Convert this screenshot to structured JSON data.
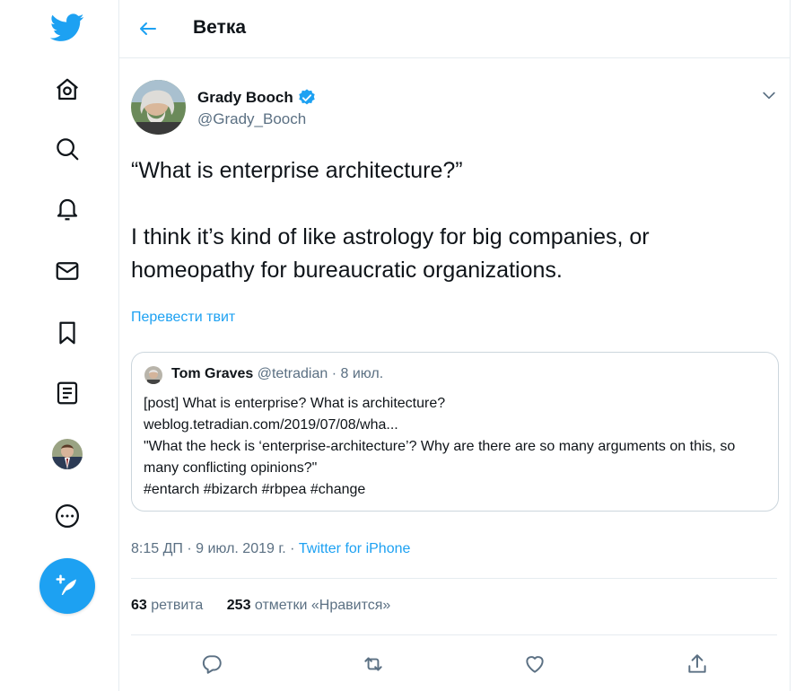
{
  "header": {
    "title": "Ветка"
  },
  "tweet": {
    "author_name": "Grady Booch",
    "author_handle": "@Grady_Booch",
    "text_lines": [
      "“What is enterprise architecture?”",
      "I think it’s kind of like astrology for big companies, or homeopathy for bureaucratic organizations."
    ],
    "translate_label": "Перевести твит",
    "time": "8:15 ДП · 9 июл. 2019 г. · ",
    "source": "Twitter for iPhone",
    "retweets_count": "63",
    "retweets_label": " ретвита",
    "likes_count": "253",
    "likes_label": " отметки «Нравится»"
  },
  "quote": {
    "author_name": "Tom Graves",
    "meta": " @tetradian · 8 июл.",
    "line1": "[post] What is enterprise? What is architecture?",
    "line2": "weblog.tetradian.com/2019/07/08/wha...",
    "line3": "\"What the heck is ‘enterprise-architecture’? Why are there are so many arguments on this, so many conflicting opinions?\"",
    "line4": "#entarch #bizarch #rbpea #change"
  },
  "nav_icons": [
    "twitter-logo-icon",
    "home-icon",
    "explore-icon",
    "notifications-icon",
    "messages-icon",
    "bookmarks-icon",
    "lists-icon",
    "profile-avatar",
    "more-icon",
    "compose-tweet-button"
  ],
  "colors": {
    "accent": "#1da1f2",
    "secondary_text": "#5b7083",
    "border": "#e6ecf0"
  }
}
